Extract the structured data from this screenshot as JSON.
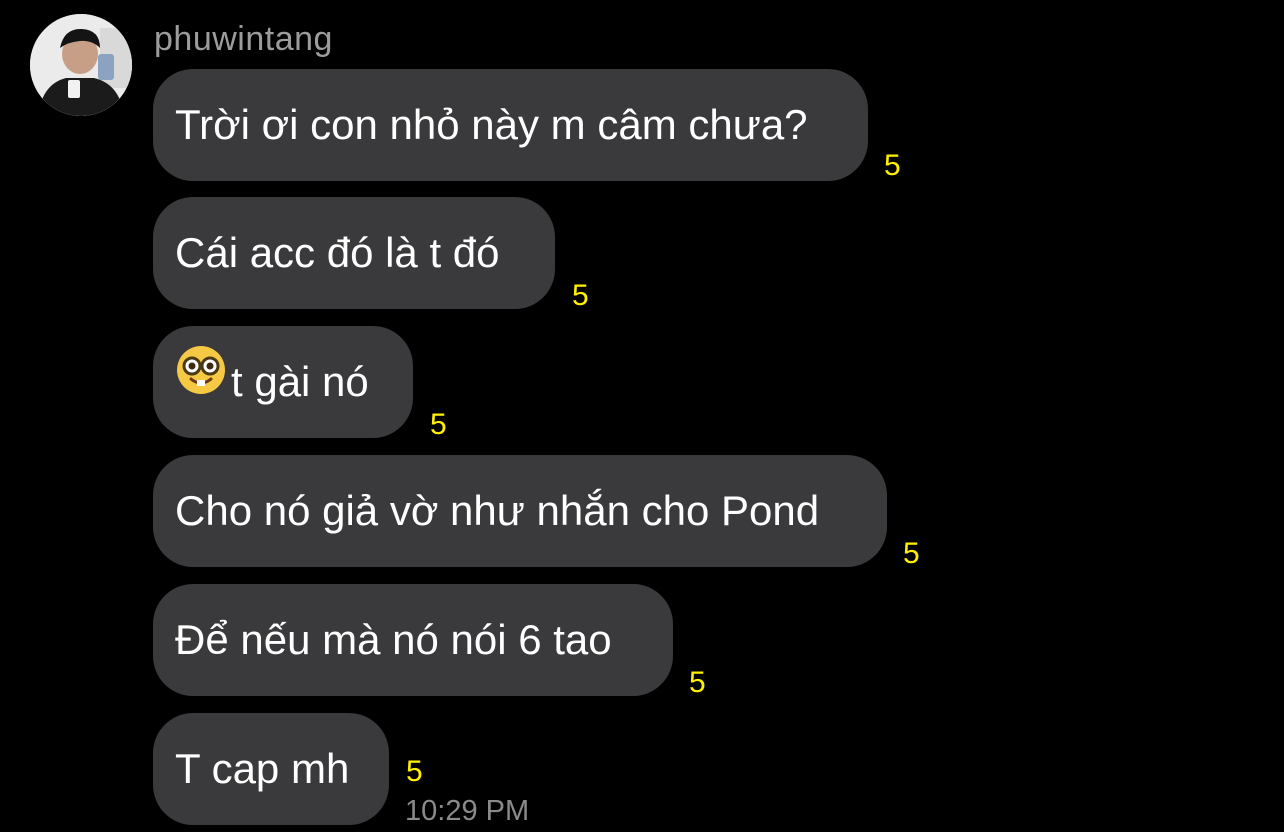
{
  "chat": {
    "sender": "phuwintang",
    "avatar_icon": "profile-photo",
    "messages": [
      {
        "text": "Trời ơi con nhỏ này m câm chưa?",
        "badge": "5"
      },
      {
        "text": "Cái acc đó là t đó",
        "badge": "5"
      },
      {
        "emoji": "nerd-face-emoji",
        "text": "t gài nó",
        "badge": "5"
      },
      {
        "text": "Cho nó giả vờ như nhắn cho Pond",
        "badge": "5"
      },
      {
        "text": "Để nếu mà nó nói 6 tao",
        "badge": "5"
      },
      {
        "text": "T cap mh",
        "badge": "5"
      }
    ],
    "timestamp": "10:29 PM"
  },
  "colors": {
    "background": "#000000",
    "bubble": "#3a3a3c",
    "badge": "#fff000",
    "sender": "#9c9c9c",
    "timestamp": "#8a8a8a"
  }
}
